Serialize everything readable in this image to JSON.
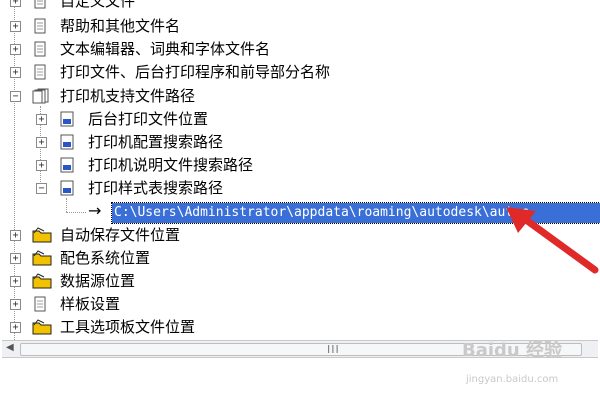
{
  "tree": {
    "items": [
      {
        "label": "自定义文件"
      },
      {
        "label": "帮助和其他文件名"
      },
      {
        "label": "文本编辑器、词典和字体文件名"
      },
      {
        "label": "打印文件、后台打印程序和前导部分名称"
      },
      {
        "label": "打印机支持文件路径"
      },
      {
        "label": "后台打印文件位置"
      },
      {
        "label": "打印机配置搜索路径"
      },
      {
        "label": "打印机说明文件搜索路径"
      },
      {
        "label": "打印样式表搜索路径"
      },
      {
        "label": "自动保存文件位置"
      },
      {
        "label": "配色系统位置"
      },
      {
        "label": "数据源位置"
      },
      {
        "label": "样板设置"
      },
      {
        "label": "工具选项板文件位置"
      }
    ],
    "selected_path": "C:\\Users\\Administrator\\appdata\\roaming\\autodesk\\autoc"
  },
  "scrollbar": {
    "grip": "III"
  },
  "watermark": {
    "brand": "Baidu 经验",
    "url": "jingyan.baidu.com"
  },
  "colors": {
    "selection": "#3a6fd8",
    "annotation_arrow": "#e02a2a",
    "folder": "#f2c200"
  }
}
